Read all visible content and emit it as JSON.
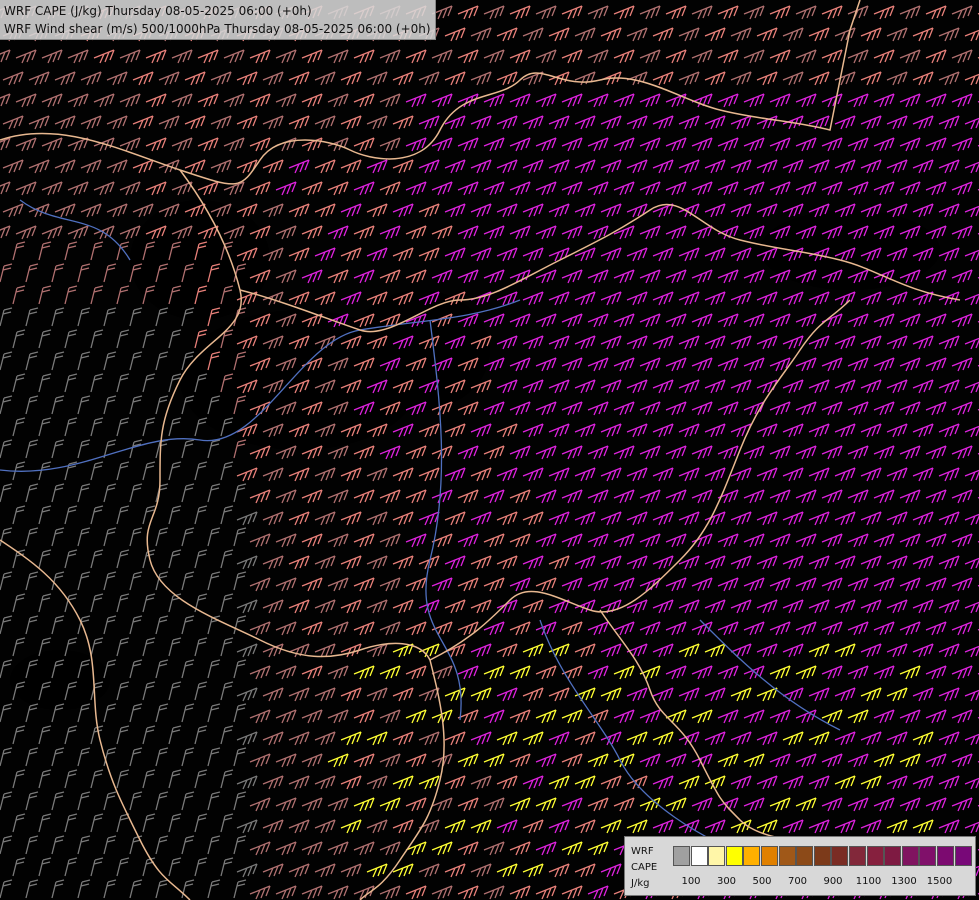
{
  "titles": {
    "line1": "WRF CAPE (J/kg) Thursday 08-05-2025 06:00 (+0h)",
    "line2": "WRF Wind shear (m/s) 500/1000hPa Thursday 08-05-2025 06:00 (+0h)"
  },
  "legend": {
    "label_line1": "WRF",
    "label_line2": "CAPE",
    "label_line3": "J/kg",
    "colors": [
      "#a0a0a0",
      "#ffffff",
      "#fff6a8",
      "#ffff00",
      "#ffb000",
      "#e08000",
      "#a05818",
      "#8c4a18",
      "#7c3a1a",
      "#7a2c24",
      "#82283a",
      "#86203e",
      "#7e1a42",
      "#801460",
      "#80106a",
      "#7c0a70",
      "#780878"
    ],
    "ticks": [
      "100",
      "300",
      "500",
      "700",
      "900",
      "1100",
      "1300",
      "1500"
    ]
  },
  "colors": {
    "background": "#000000",
    "barb_gray": "#7a7a7a",
    "barb_mauve": "#b07070",
    "barb_salmon": "#e8807a",
    "barb_magenta": "#dd22dd",
    "barb_yellow": "#ffff33",
    "border": "#e8b890",
    "river": "#5070c0"
  }
}
